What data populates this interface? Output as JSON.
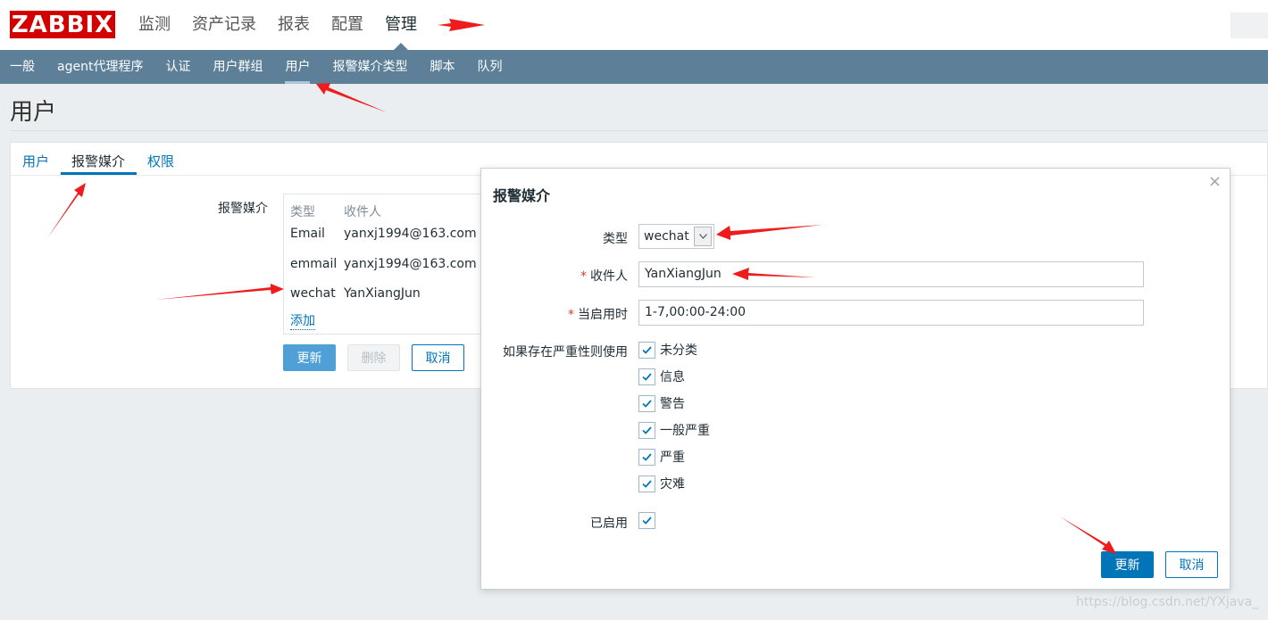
{
  "logo": "ZABBIX",
  "top_menu": [
    "监测",
    "资产记录",
    "报表",
    "配置",
    "管理"
  ],
  "sub_menu": [
    "一般",
    "agent代理程序",
    "认证",
    "用户群组",
    "用户",
    "报警媒介类型",
    "脚本",
    "队列"
  ],
  "page_title": "用户",
  "tabs": [
    "用户",
    "报警媒介",
    "权限"
  ],
  "media_form": {
    "label": "报警媒介",
    "col_type": "类型",
    "col_recipient": "收件人",
    "rows": [
      {
        "type": "Email",
        "recipient": "yanxj1994@163.com"
      },
      {
        "type": "emmail",
        "recipient": "yanxj1994@163.com"
      },
      {
        "type": "wechat",
        "recipient": "YanXiangJun"
      }
    ],
    "add_link": "添加",
    "update_btn": "更新",
    "delete_btn": "删除",
    "cancel_btn": "取消"
  },
  "modal": {
    "title": "报警媒介",
    "close": "×",
    "type_label": "类型",
    "type_value": "wechat",
    "required_mark": "*",
    "recipient_label": "收件人",
    "recipient_value": "YanXiangJun",
    "when_active_label": "当启用时",
    "when_active_value": "1-7,00:00-24:00",
    "severity_label": "如果存在严重性则使用",
    "severities": [
      "未分类",
      "信息",
      "警告",
      "一般严重",
      "严重",
      "灾难"
    ],
    "enabled_label": "已启用",
    "update_btn": "更新",
    "cancel_btn": "取消"
  },
  "watermark": "https://blog.csdn.net/YXjava_"
}
